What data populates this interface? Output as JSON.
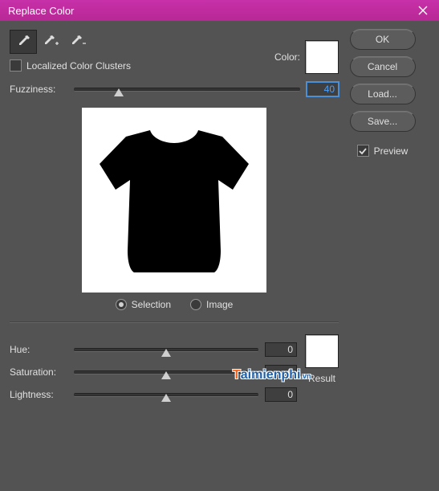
{
  "title": "Replace Color",
  "tools": {
    "eyedropper": true,
    "add": false,
    "subtract": false
  },
  "color_label": "Color:",
  "color_swatch": "#ffffff",
  "localized_checked": false,
  "localized_label": "Localized Color Clusters",
  "fuzziness_label": "Fuzziness:",
  "fuzziness_value": "40",
  "radio": {
    "selection": "Selection",
    "image": "Image",
    "selected": "selection"
  },
  "hue_label": "Hue:",
  "hue_value": "0",
  "sat_label": "Saturation:",
  "sat_value": "0",
  "light_label": "Lightness:",
  "light_value": "0",
  "result_label": "Result",
  "result_swatch": "#ffffff",
  "buttons": {
    "ok": "OK",
    "cancel": "Cancel",
    "load": "Load...",
    "save": "Save..."
  },
  "preview_checked": true,
  "preview_label": "Preview"
}
